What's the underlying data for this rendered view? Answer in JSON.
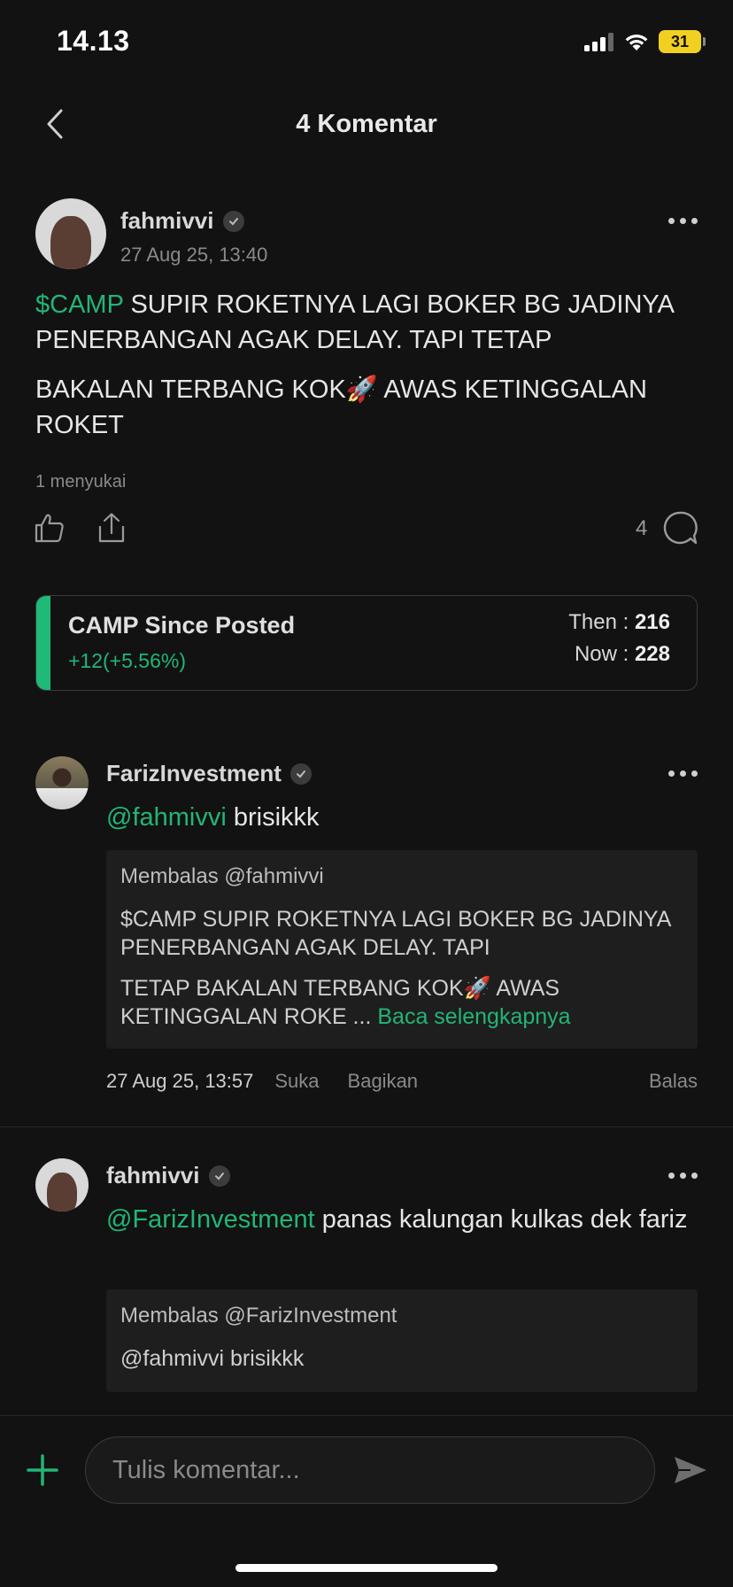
{
  "status_bar": {
    "time": "14.13",
    "battery": "31"
  },
  "header": {
    "title": "4 Komentar"
  },
  "post": {
    "username": "fahmivvi",
    "timestamp": "27 Aug 25, 13:40",
    "ticker": "$CAMP",
    "text_line1_rest": " SUPIR ROKETNYA LAGI BOKER BG JADINYA PENERBANGAN AGAK DELAY. TAPI TETAP",
    "text_line2": "BAKALAN TERBANG KOK🚀 AWAS KETINGGALAN ROKET",
    "likes": "1 menyukai",
    "comment_count": "4"
  },
  "camp_card": {
    "title": "CAMP Since Posted",
    "change": "+12(+5.56%)",
    "then_label": "Then : ",
    "then_value": "216",
    "now_label": "Now : ",
    "now_value": "228"
  },
  "comments": [
    {
      "username": "FarizInvestment",
      "mention": "@fahmivvi",
      "text": " brisikkk",
      "quote_label": "Membalas  @fahmivvi",
      "quote_p1": "$CAMP SUPIR ROKETNYA LAGI BOKER BG JADINYA PENERBANGAN AGAK DELAY. TAPI",
      "quote_p2": "TETAP BAKALAN TERBANG KOK🚀 AWAS KETINGGALAN ROKE ... ",
      "read_more": "Baca selengkapnya",
      "date": "27 Aug 25, 13:57",
      "like": "Suka",
      "share": "Bagikan",
      "reply": "Balas"
    },
    {
      "username": "fahmivvi",
      "mention": "@FarizInvestment",
      "text": " panas kalungan kulkas dek fariz",
      "quote_label": "Membalas  @FarizInvestment",
      "quote_p1": "@fahmivvi brisikkk"
    }
  ],
  "composer": {
    "placeholder": "Tulis komentar..."
  },
  "colors": {
    "accent": "#22b576",
    "background": "#121212"
  }
}
